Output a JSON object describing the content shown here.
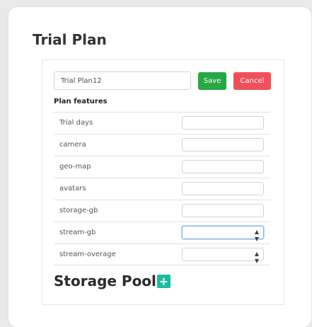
{
  "page": {
    "title": "Trial Plan"
  },
  "form": {
    "plan_name_value": "Trial Plan12",
    "save_label": "Save",
    "cancel_label": "Cancel",
    "features_heading": "Plan features",
    "features": [
      {
        "label": "Trial days",
        "control": "text",
        "value": ""
      },
      {
        "label": "camera",
        "control": "text",
        "value": ""
      },
      {
        "label": "geo-map",
        "control": "text",
        "value": ""
      },
      {
        "label": "avatars",
        "control": "text",
        "value": ""
      },
      {
        "label": "storage-gb",
        "control": "text",
        "value": ""
      },
      {
        "label": "stream-gb",
        "control": "select",
        "value": "",
        "focused": true
      },
      {
        "label": "stream-overage",
        "control": "select",
        "value": ""
      }
    ]
  },
  "storage": {
    "title": "Storage Pools",
    "add_icon": "plus-icon"
  },
  "colors": {
    "save": "#28a745",
    "cancel": "#f0505a",
    "add": "#1abc9c"
  }
}
